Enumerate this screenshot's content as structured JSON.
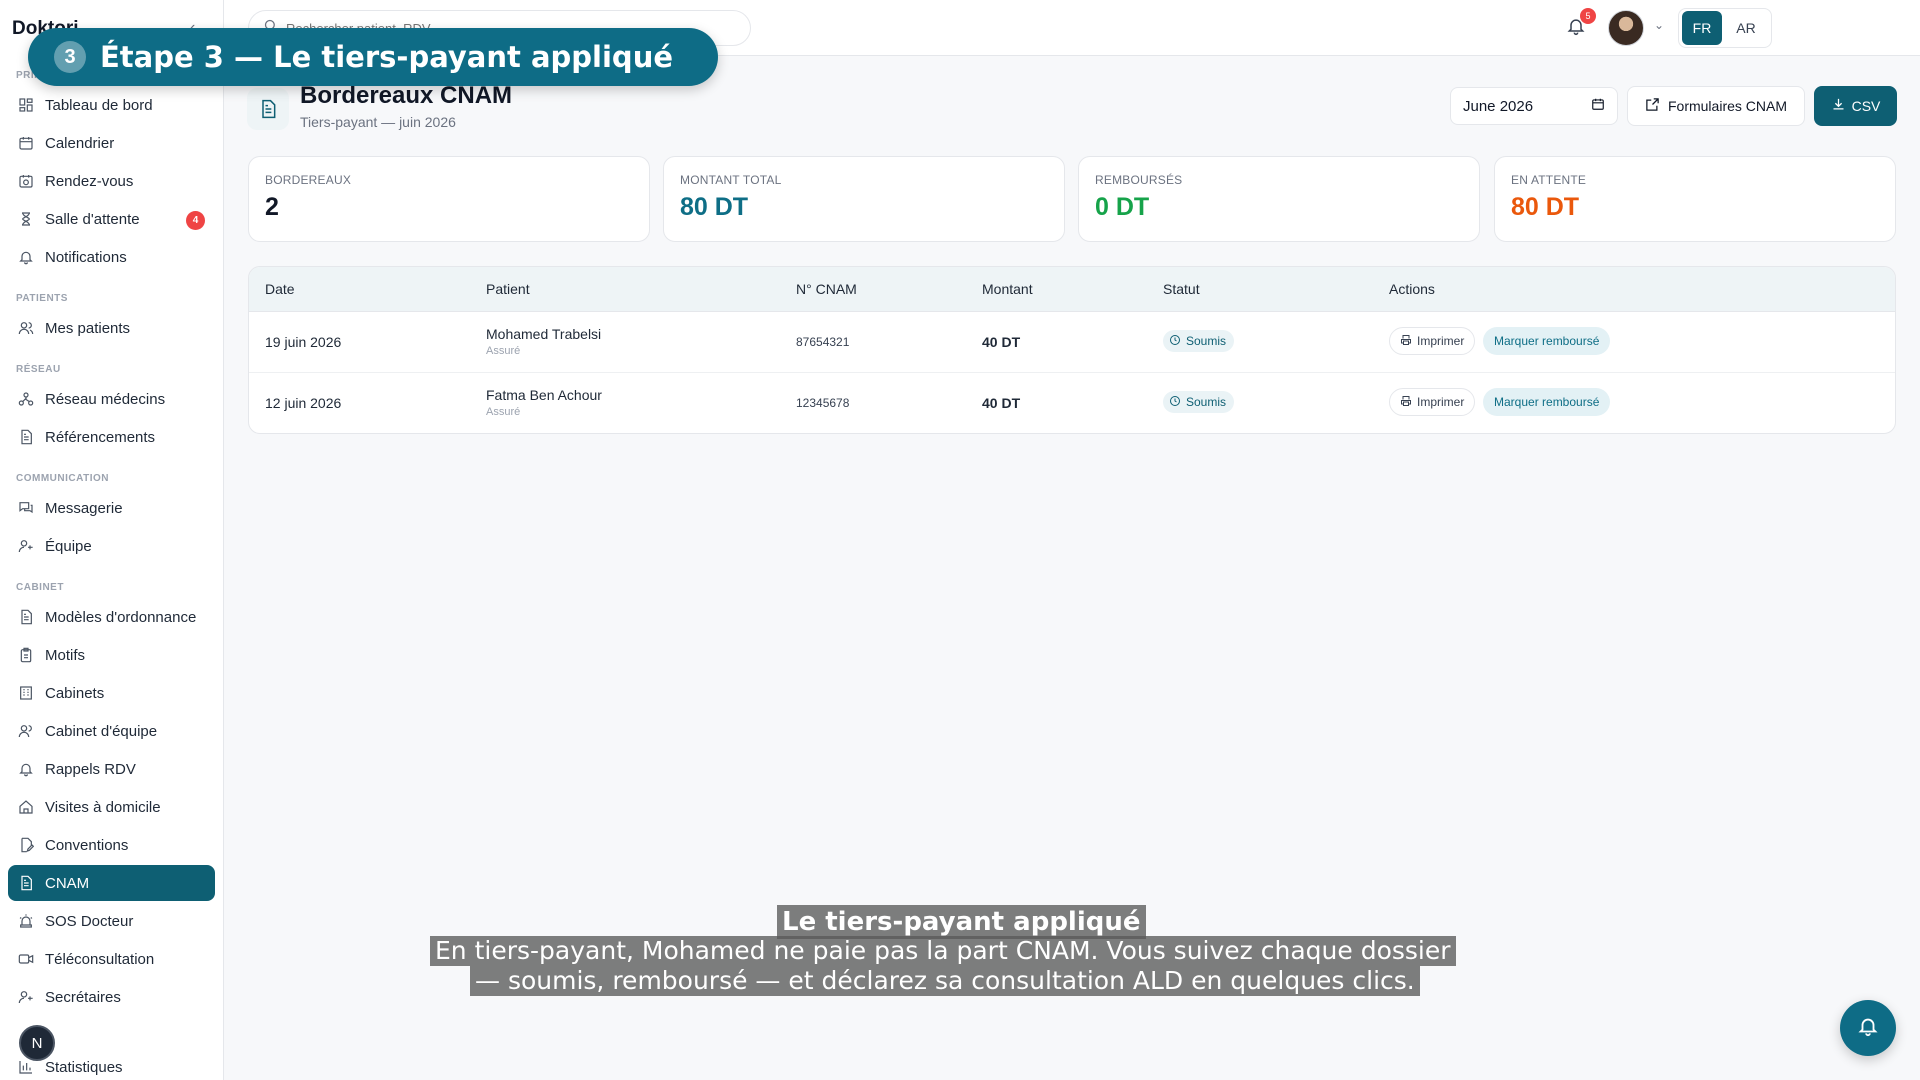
{
  "app": {
    "brand": "Doktori"
  },
  "topbar": {
    "search_placeholder": "Rechercher patient, RDV...",
    "lang": [
      "FR",
      "AR"
    ],
    "active_lang": "FR",
    "notification_count": "5"
  },
  "sidebar": {
    "sections": {
      "principal": "PRINCIPAL",
      "patients": "PATIENTS",
      "reseau": "RÉSEAU",
      "communication": "COMMUNICATION",
      "cabinet": "CABINET"
    },
    "items": [
      {
        "label": "Tableau de bord",
        "icon": "dashboard-icon"
      },
      {
        "label": "Calendrier",
        "icon": "calendar-icon"
      },
      {
        "label": "Rendez-vous",
        "icon": "calendar-clock-icon"
      },
      {
        "label": "Salle d'attente",
        "icon": "hourglass-icon",
        "badge": "4"
      },
      {
        "label": "Notifications",
        "icon": "bell-icon"
      },
      {
        "label": "Mes patients",
        "icon": "users-icon"
      },
      {
        "label": "Réseau médecins",
        "icon": "network-icon"
      },
      {
        "label": "Référencements",
        "icon": "document-icon"
      },
      {
        "label": "Messagerie",
        "icon": "messages-icon"
      },
      {
        "label": "Équipe",
        "icon": "user-team-icon"
      },
      {
        "label": "Modèles d'ordonnance",
        "icon": "document-icon"
      },
      {
        "label": "Motifs",
        "icon": "clipboard-icon"
      },
      {
        "label": "Cabinets",
        "icon": "building-icon"
      },
      {
        "label": "Cabinet d'équipe",
        "icon": "users-icon"
      },
      {
        "label": "Rappels RDV",
        "icon": "bell-icon"
      },
      {
        "label": "Visites à domicile",
        "icon": "home-icon"
      },
      {
        "label": "Conventions",
        "icon": "document-edit-icon"
      },
      {
        "label": "CNAM",
        "icon": "document-icon",
        "active": true
      },
      {
        "label": "SOS Docteur",
        "icon": "siren-icon"
      },
      {
        "label": "Téléconsultation",
        "icon": "video-icon"
      },
      {
        "label": "Secrétaires",
        "icon": "user-team-icon"
      },
      {
        "label": "Statistiques",
        "icon": "bar-chart-icon"
      }
    ],
    "user_initial": "N"
  },
  "page": {
    "title": "Bordereaux CNAM",
    "subtitle": "Tiers-payant — juin 2026",
    "month": "June 2026",
    "forms_button": "Formulaires CNAM",
    "csv_button": "CSV"
  },
  "stats": [
    {
      "label": "BORDEREAUX",
      "value": "2",
      "color": "#111827"
    },
    {
      "label": "MONTANT TOTAL",
      "value": "80 DT",
      "color": "#0e6e86"
    },
    {
      "label": "REMBOURSÉS",
      "value": "0 DT",
      "color": "#16a34a"
    },
    {
      "label": "EN ATTENTE",
      "value": "80 DT",
      "color": "#ea580c"
    }
  ],
  "table": {
    "headers": [
      "Date",
      "Patient",
      "N° CNAM",
      "Montant",
      "Statut",
      "Actions"
    ],
    "rows": [
      {
        "date": "19 juin 2026",
        "patient": "Mohamed Trabelsi",
        "patient_sub": "Assuré",
        "cnam": "87654321",
        "amount": "40 DT",
        "status": "Soumis",
        "print": "Imprimer",
        "refund": "Marquer remboursé"
      },
      {
        "date": "12 juin 2026",
        "patient": "Fatma Ben Achour",
        "patient_sub": "Assuré",
        "cnam": "12345678",
        "amount": "40 DT",
        "status": "Soumis",
        "print": "Imprimer",
        "refund": "Marquer remboursé"
      }
    ]
  },
  "overlay": {
    "step_number": "3",
    "step_text": "Étape 3 — Le tiers-payant appliqué",
    "caption_title": "Le tiers-payant appliqué",
    "caption_line1": "En tiers-payant, Mohamed ne paie pas la part CNAM. Vous suivez chaque dossier",
    "caption_line2": "— soumis, remboursé — et déclarez sa consultation ALD en quelques clics."
  },
  "colors": {
    "accent": "#0e5f73",
    "badge": "#ef4444"
  }
}
